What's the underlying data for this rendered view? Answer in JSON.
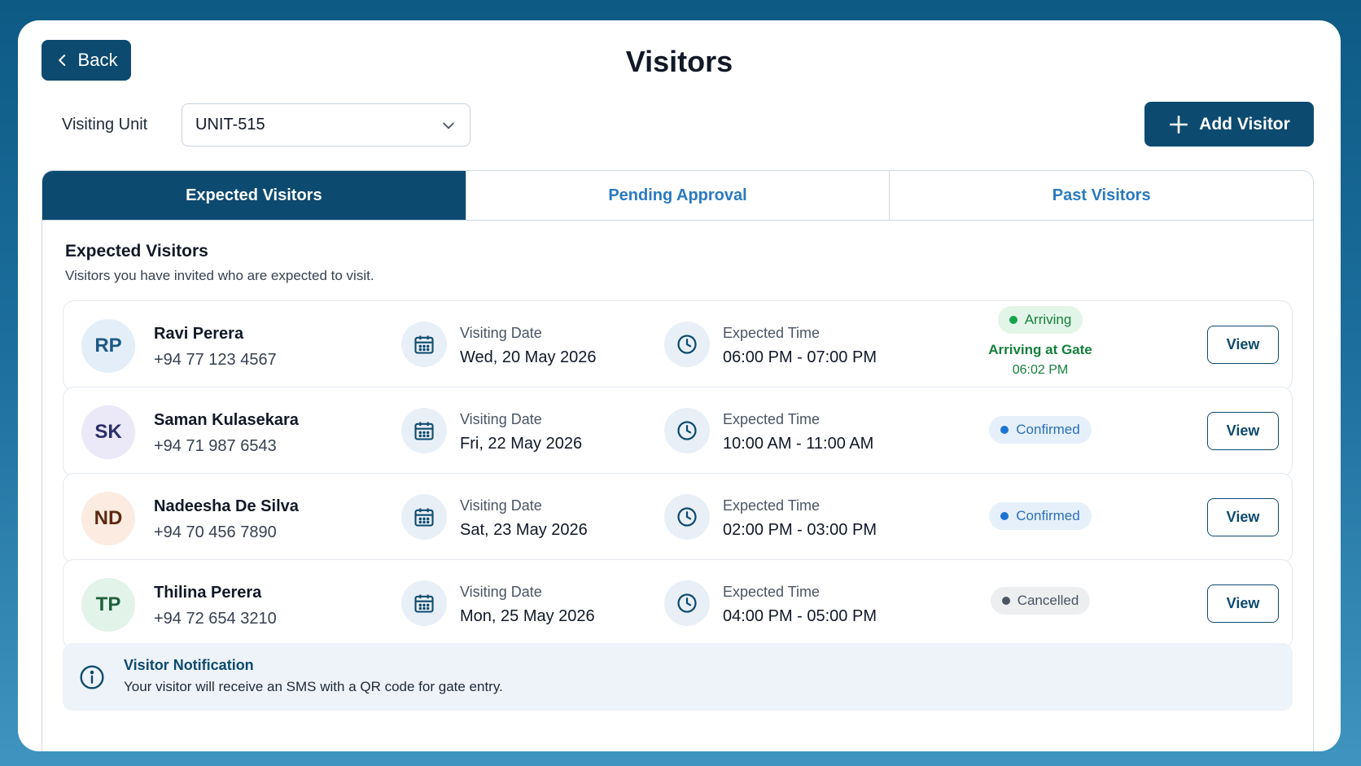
{
  "header": {
    "back_label": "Back",
    "title": "Visitors",
    "add_label": "Add Visitor"
  },
  "unit": {
    "label": "Visiting Unit",
    "selected": "UNIT-515"
  },
  "tabs": [
    {
      "label": "Expected Visitors",
      "active": true
    },
    {
      "label": "Pending Approval",
      "active": false
    },
    {
      "label": "Past Visitors",
      "active": false
    }
  ],
  "section": {
    "title": "Expected Visitors",
    "subtitle": "Visitors you have invited who are expected to visit."
  },
  "labels": {
    "date": "Visiting Date",
    "time": "Expected Time",
    "view": "View"
  },
  "visitors": [
    {
      "initials": "RP",
      "name": "Ravi Perera",
      "phone": "+94 77 123 4567",
      "date": "Wed, 20 May 2026",
      "time": "06:00 PM - 07:00 PM",
      "status": "Arriving",
      "gate_text": "Arriving at Gate",
      "gate_time": "06:02 PM"
    },
    {
      "initials": "SK",
      "name": "Saman Kulasekara",
      "phone": "+94 71 987 6543",
      "date": "Fri, 22 May 2026",
      "time": "10:00 AM - 11:00 AM",
      "status": "Confirmed"
    },
    {
      "initials": "ND",
      "name": "Nadeesha De Silva",
      "phone": "+94 70 456 7890",
      "date": "Sat, 23 May 2026",
      "time": "02:00 PM - 03:00 PM",
      "status": "Confirmed"
    },
    {
      "initials": "TP",
      "name": "Thilina Perera",
      "phone": "+94 72 654 3210",
      "date": "Mon, 25 May 2026",
      "time": "04:00 PM - 05:00 PM",
      "status": "Cancelled"
    }
  ],
  "notice": {
    "title": "Visitor Notification",
    "text": "Your visitor will receive an SMS with a QR code for gate entry."
  },
  "colors": {
    "primary": "#0d4a6f",
    "tab_text": "#2a7abf",
    "arriving": "#15803d",
    "confirmed": "#2a6fb5",
    "cancelled": "#4b5563"
  }
}
